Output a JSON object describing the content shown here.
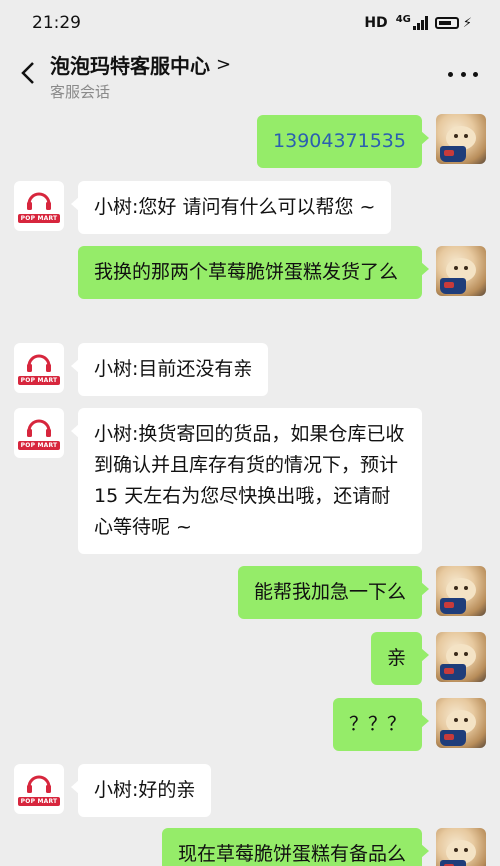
{
  "status_bar": {
    "time": "21:29",
    "hd": "HD",
    "network": "4G"
  },
  "header": {
    "title": "泡泡玛特客服中心",
    "chevron": ">",
    "subtitle": "客服会话"
  },
  "brand": {
    "logo_text": "POP MART",
    "accent": "#d7263d",
    "bubble_green": "#95ec69"
  },
  "messages": [
    {
      "side": "right",
      "text": "13904371535"
    },
    {
      "side": "left",
      "text": "小树:您好 请问有什么可以帮您 ~"
    },
    {
      "side": "right",
      "text": "我换的那两个草莓脆饼蛋糕发货了么"
    },
    {
      "side": "left",
      "text": "小树:目前还没有亲"
    },
    {
      "side": "left",
      "text": "小树:换货寄回的货品，如果仓库已收到确认并且库存有货的情况下，预计 15 天左右为您尽快换出哦，还请耐心等待呢 ~"
    },
    {
      "side": "right",
      "text": "能帮我加急一下么"
    },
    {
      "side": "right",
      "text": "亲"
    },
    {
      "side": "right",
      "text": "？？？"
    },
    {
      "side": "left",
      "text": "小树:好的亲"
    },
    {
      "side": "right",
      "text": "现在草莓脆饼蛋糕有备品么"
    }
  ]
}
